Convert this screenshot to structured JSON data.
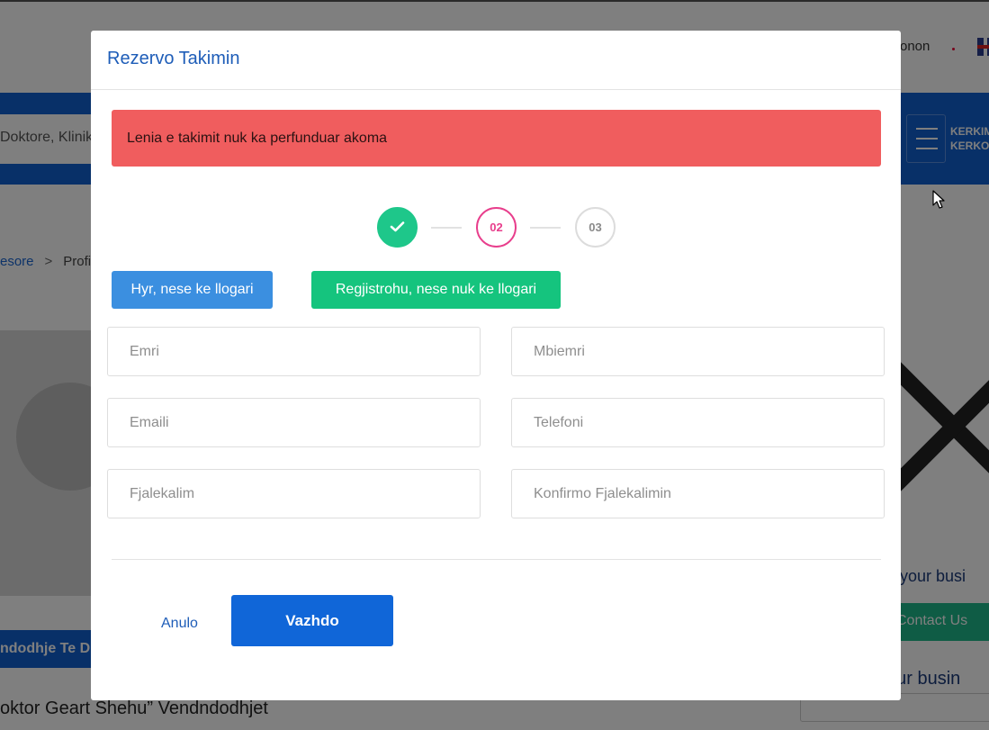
{
  "background": {
    "header_text": "onon",
    "search_placeholder": "Doktore, Klinik",
    "filter_label_line1": "KERKIM",
    "filter_label_line2": "KERKO",
    "breadcrumb": {
      "link": "esore",
      "separator": ">",
      "current": "Profi"
    },
    "business_text": "e your busi",
    "contact_button": "Contact Us",
    "business_text_2": "our busin",
    "location_button": "ndodhje Te D",
    "doctor_heading": "oktor Geart Shehu” Vendndodhjet"
  },
  "modal": {
    "title": "Rezervo Takimin",
    "alert": "Lenia e takimit nuk ka perfunduar akoma",
    "steps": {
      "step2": "02",
      "step3": "03",
      "current_step": 2
    },
    "tabs": {
      "login": "Hyr, nese ke llogari",
      "register": "Regjistrohu, nese nuk ke llogari"
    },
    "fields": {
      "first_name": "Emri",
      "last_name": "Mbiemri",
      "email": "Emaili",
      "phone": "Telefoni",
      "password": "Fjalekalim",
      "confirm_password": "Konfirmo Fjalekalimin"
    },
    "cancel": "Anulo",
    "continue": "Vazhdo"
  },
  "colors": {
    "alert_bg": "#f05d5e",
    "step_done": "#1ec78a",
    "step_active": "#e83e8c",
    "tab_login": "#3b8fe0",
    "tab_register": "#15c47e",
    "primary": "#1066d8"
  },
  "icons": {
    "step_done": "check-icon",
    "cursor": "mouse-cursor-icon"
  }
}
